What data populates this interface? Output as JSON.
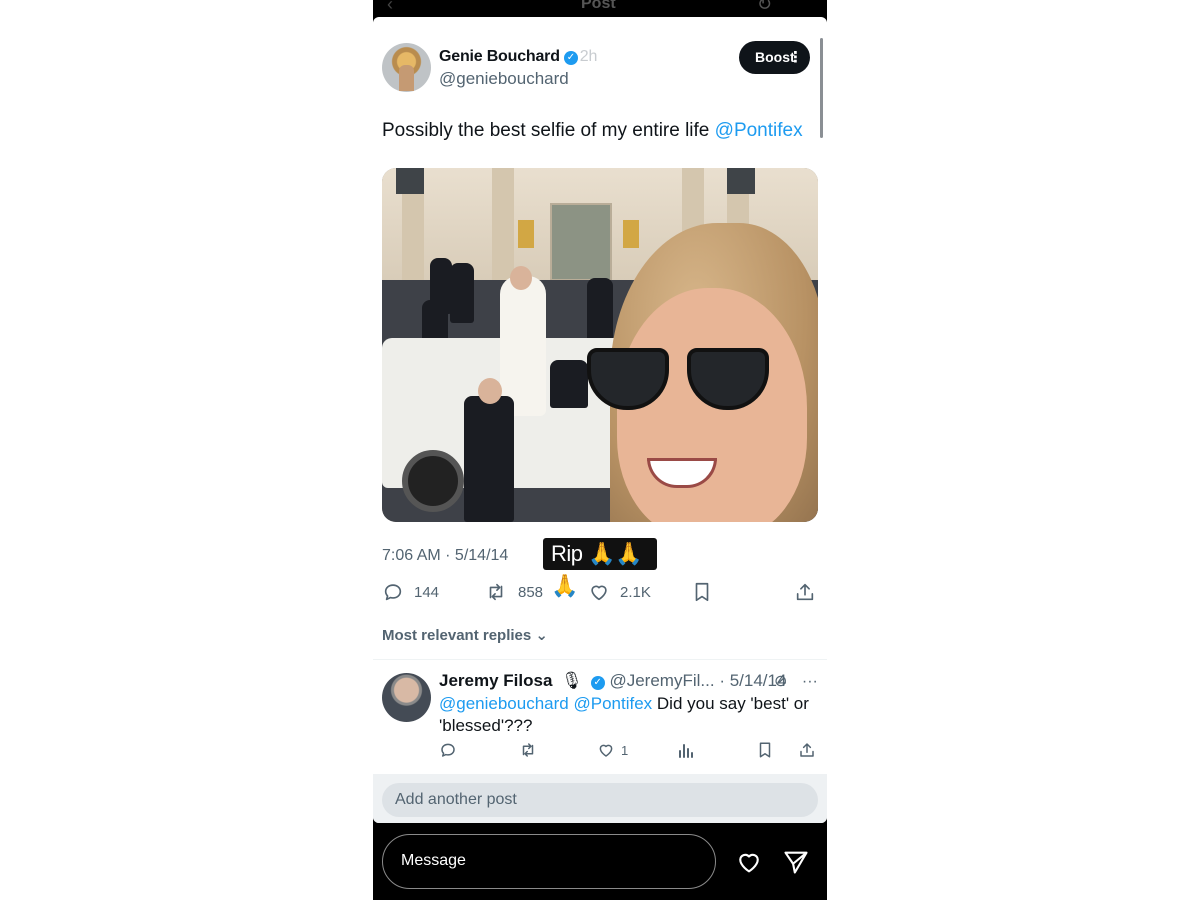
{
  "header": {
    "back_icon": "‹",
    "title": "Post",
    "refresh_icon": "↻",
    "story_progress": 0.32
  },
  "post": {
    "author_name": "Genie Bouchard",
    "verified_icon": "✓",
    "time_ago": "2h",
    "handle": "@geniebouchard",
    "boost_label": "Boost",
    "more_icon": "⋮",
    "text_before_mention": "Possibly the best selfie of my entire life ",
    "mention": "@Pontifex",
    "timestamp": "7:06 AM · 5/14/14",
    "stats": {
      "replies": "144",
      "reposts": "858",
      "likes": "2.1K"
    }
  },
  "sticker": {
    "text": "Rip 🙏🙏🙏"
  },
  "replies_section": {
    "label": "Most relevant replies",
    "chevron": "⌄"
  },
  "reply": {
    "name": "Jeremy Filosa",
    "mic_icon": "🎙",
    "handle": "@JeremyFil...",
    "date": "· 5/14/14",
    "mention_1": "@geniebouchard",
    "mention_2": "@Pontifex",
    "text": " Did you say 'best' or 'blessed'???",
    "likes": "1",
    "grok_icon": "⊘",
    "more_icon": "···"
  },
  "add_post": {
    "placeholder": "Add another post"
  },
  "story_footer": {
    "message_placeholder": "Message"
  },
  "colors": {
    "accent": "#1d9bf0",
    "text": "#0f1419",
    "muted": "#536471",
    "boost_bg": "#0f1419"
  }
}
